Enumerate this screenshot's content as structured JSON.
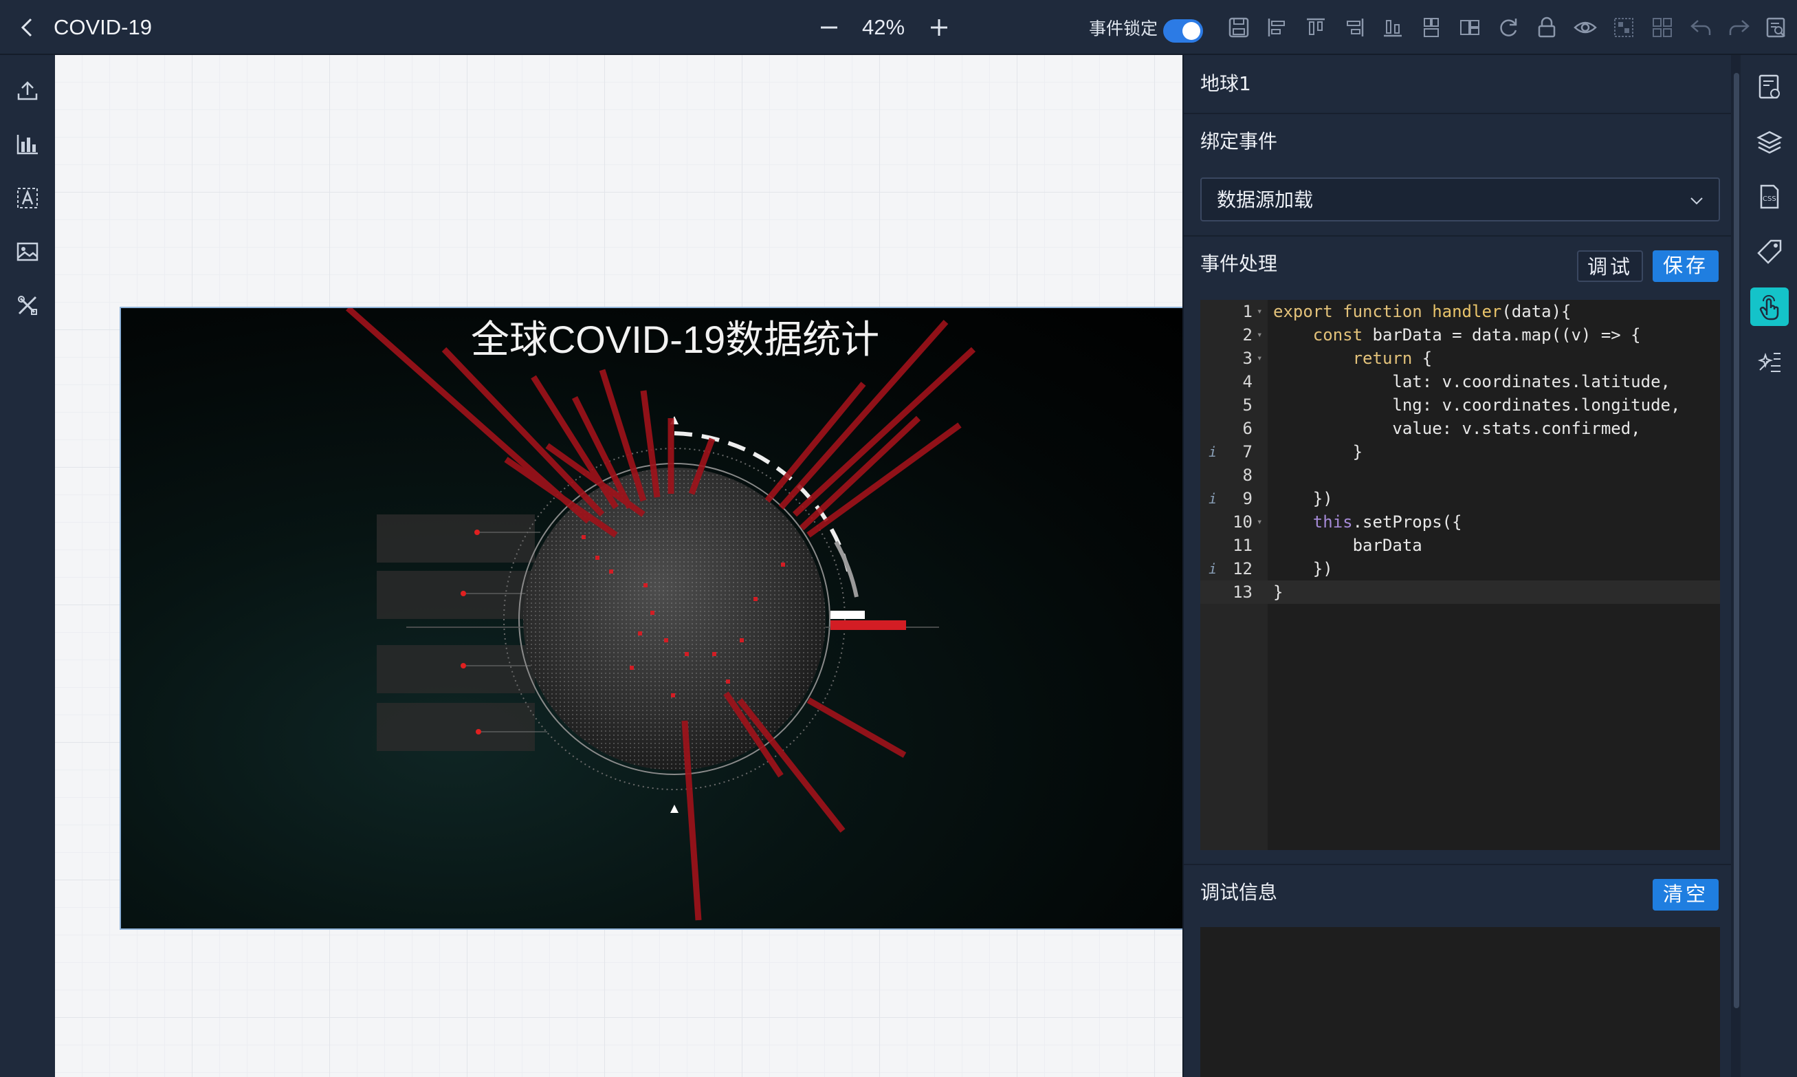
{
  "header": {
    "title": "COVID-19",
    "zoom": "42%",
    "lock_label": "事件锁定",
    "lock_on": true,
    "toolbar_icons": [
      "save-icon",
      "align-left-icon",
      "align-top-icon",
      "align-right-icon",
      "align-bottom-icon",
      "distribute-vertical-icon",
      "distribute-horizontal-icon",
      "refresh-icon",
      "lock-icon",
      "eye-icon",
      "group-icon",
      "ungroup-icon",
      "undo-icon",
      "redo-icon",
      "preview-icon"
    ]
  },
  "left_sidebar": {
    "icons": [
      "upload-icon",
      "bar-chart-icon",
      "text-icon",
      "image-icon",
      "tools-icon"
    ]
  },
  "stage": {
    "title": "全球COVID-19数据统计"
  },
  "panel": {
    "component_name": "地球1",
    "bind_event_label": "绑定事件",
    "bind_event_value": "数据源加载",
    "event_handler_label": "事件处理",
    "debug_button": "调试",
    "save_button": "保存",
    "code_lines": [
      {
        "n": "1",
        "fold": "▾",
        "info": "",
        "code": "export function handler(data){"
      },
      {
        "n": "2",
        "fold": "▾",
        "info": "",
        "code": "    const barData = data.map((v) => {"
      },
      {
        "n": "3",
        "fold": "▾",
        "info": "",
        "code": "        return {"
      },
      {
        "n": "4",
        "fold": "",
        "info": "",
        "code": "            lat: v.coordinates.latitude,"
      },
      {
        "n": "5",
        "fold": "",
        "info": "",
        "code": "            lng: v.coordinates.longitude,"
      },
      {
        "n": "6",
        "fold": "",
        "info": "",
        "code": "            value: v.stats.confirmed,"
      },
      {
        "n": "7",
        "fold": "",
        "info": "i",
        "code": "        }"
      },
      {
        "n": "8",
        "fold": "",
        "info": "",
        "code": ""
      },
      {
        "n": "9",
        "fold": "",
        "info": "i",
        "code": "    })"
      },
      {
        "n": "10",
        "fold": "▾",
        "info": "",
        "code": "    this.setProps({"
      },
      {
        "n": "11",
        "fold": "",
        "info": "",
        "code": "        barData"
      },
      {
        "n": "12",
        "fold": "",
        "info": "i",
        "code": "    })"
      },
      {
        "n": "13",
        "fold": "",
        "info": "",
        "code": "}"
      }
    ],
    "debug_info_label": "调试信息",
    "clear_button": "清空"
  },
  "right_sidebar": {
    "icons": [
      "page-settings-icon",
      "layers-icon",
      "css-icon",
      "tag-icon",
      "event-hand-icon",
      "effects-icon"
    ],
    "active_index": 4,
    "active_color": "#14c3c9"
  },
  "colors": {
    "accent": "#1f7ee0",
    "bar_red": "#c4151c",
    "bg": "#1f2a3c"
  }
}
